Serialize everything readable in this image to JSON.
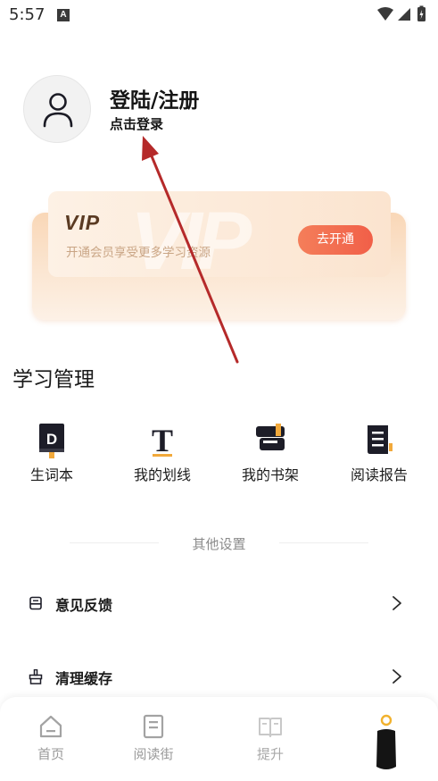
{
  "status_bar": {
    "time": "5:57",
    "notification_icon": "a-notification-icon",
    "icons": [
      "wifi-icon",
      "signal-icon",
      "battery-icon"
    ]
  },
  "profile": {
    "avatar_icon": "user-icon",
    "title": "登陆/注册",
    "subtitle": "点击登录"
  },
  "vip_card": {
    "logo": "VIP",
    "watermark": "VIP",
    "description": "开通会员享受更多学习资源",
    "button_label": "去开通"
  },
  "learning": {
    "title": "学习管理",
    "items": [
      {
        "label": "生词本",
        "icon": "vocabulary-book-icon"
      },
      {
        "label": "我的划线",
        "icon": "underline-t-icon"
      },
      {
        "label": "我的书架",
        "icon": "bookshelf-icon"
      },
      {
        "label": "阅读报告",
        "icon": "reading-report-icon"
      }
    ]
  },
  "other": {
    "divider_label": "其他设置",
    "rows": [
      {
        "label": "意见反馈",
        "icon": "feedback-icon"
      },
      {
        "label": "清理缓存",
        "icon": "clean-cache-icon"
      }
    ]
  },
  "tabbar": {
    "tabs": [
      {
        "label": "首页",
        "icon": "home-icon"
      },
      {
        "label": "阅读街",
        "icon": "reading-street-icon"
      },
      {
        "label": "提升",
        "icon": "open-book-icon"
      },
      {
        "label": "",
        "icon": "profile-tab-icon"
      }
    ]
  },
  "colors": {
    "accent": "#f26a4f",
    "vip_text": "#5a3a22",
    "annotation_arrow": "#b52a2a",
    "tab_inactive": "#9a9a9a"
  }
}
